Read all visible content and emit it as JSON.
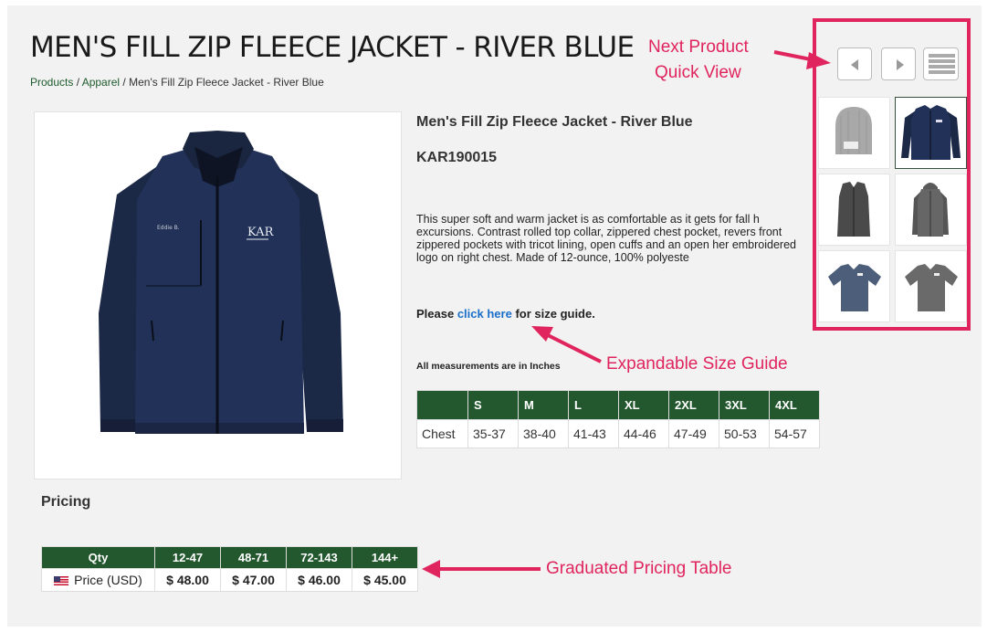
{
  "page": {
    "title": "MEN'S FILL ZIP FLEECE JACKET - RIVER BLUE",
    "breadcrumb": [
      {
        "label": "Products",
        "link": true
      },
      {
        "label": "Apparel",
        "link": true
      },
      {
        "label": "Men's Fill Zip Fleece Jacket - River Blue",
        "link": false
      }
    ],
    "breadcrumb_separator": " / "
  },
  "product": {
    "name": "Men's Fill Zip Fleece Jacket - River Blue",
    "sku": "KAR190015",
    "description": "This super soft and warm jacket is as comfortable as it gets for fall h excursions. Contrast rolled top collar, zippered chest pocket, revers front zippered pockets with tricot lining, open cuffs and an open her embroidered logo on right chest. Made of 12-ounce, 100% polyeste",
    "image_icon": "fleece-jacket-image",
    "logo_text": "KAR"
  },
  "size_guide": {
    "prefix": "Please ",
    "link_label": "click here",
    "suffix": " for size guide.",
    "measurement_note": "All measurements are in Inches",
    "headers": [
      "",
      "S",
      "M",
      "L",
      "XL",
      "2XL",
      "3XL",
      "4XL"
    ],
    "rows": [
      {
        "label": "Chest",
        "values": [
          "35-37",
          "38-40",
          "41-43",
          "44-46",
          "47-49",
          "50-53",
          "54-57"
        ]
      }
    ]
  },
  "pricing": {
    "title": "Pricing",
    "headers": [
      "Qty",
      "12-47",
      "48-71",
      "72-143",
      "144+"
    ],
    "row_label": "Price (USD)",
    "flag_icon": "us-flag-icon",
    "values": [
      "$ 48.00",
      "$ 47.00",
      "$ 46.00",
      "$ 45.00"
    ]
  },
  "quick_view": {
    "prev_icon": "chevron-left-icon",
    "next_icon": "chevron-right-icon",
    "grid_icon": "list-icon",
    "thumbnails": [
      {
        "name": "thumb-beanie",
        "selected": false
      },
      {
        "name": "thumb-fleece-jacket",
        "selected": true
      },
      {
        "name": "thumb-vest",
        "selected": false
      },
      {
        "name": "thumb-hooded-jacket",
        "selected": false
      },
      {
        "name": "thumb-polo-blue",
        "selected": false
      },
      {
        "name": "thumb-polo-grey",
        "selected": false
      }
    ]
  },
  "annotations": {
    "next_product": "Next Product",
    "quick_view": "Quick View",
    "size_guide": "Expandable Size Guide",
    "pricing_table": "Graduated Pricing Table",
    "color": "#e0245e"
  },
  "colors": {
    "table_header": "#23582f",
    "link": "#1a6fc9",
    "breadcrumb_link": "#1d5a2c"
  }
}
